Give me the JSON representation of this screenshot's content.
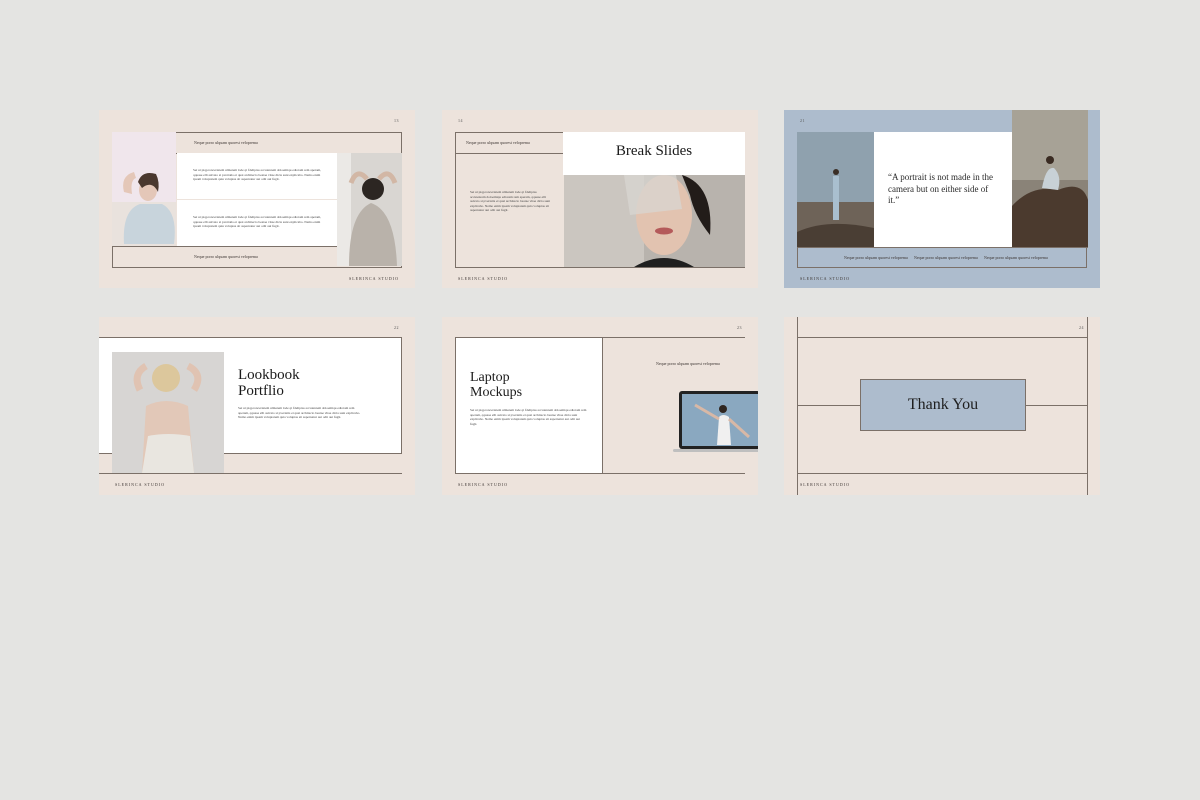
{
  "studio_name": "SLERINCA STUDIO",
  "lorem_short": "Neque porro ulquam quorest veloprema",
  "lorem_para": "Set ut piqpconcertatem ulmatem lode qi fdeliptas accutenrem doloemiqu edtotam rem aperam, qquase elli asivato si pvertatis et qusi architecto beatae vitae dicta sunt explicabo. Nemo enim ipsam voluptatem quia voluptas sit aspernatur aut odit aut fugit.",
  "slides": [
    {
      "page": "13"
    },
    {
      "page": "14",
      "title": "Break Slides"
    },
    {
      "page": "21",
      "quote": "“A portrait is not made in the camera but on either side of it.”"
    },
    {
      "page": "22",
      "title_line1": "Lookbook",
      "title_line2": "Portflio"
    },
    {
      "page": "23",
      "title_line1": "Laptop",
      "title_line2": "Mockups"
    },
    {
      "page": "24",
      "title": "Thank You"
    }
  ],
  "colors": {
    "background": "#e4e4e2",
    "beige": "#ede3dc",
    "blue": "#adbccd"
  }
}
